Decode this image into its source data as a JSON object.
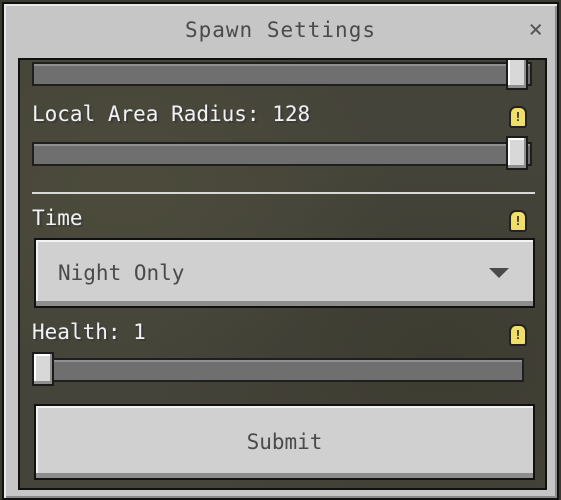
{
  "dialog": {
    "title": "Spawn Settings",
    "close_label": "×"
  },
  "settings": [
    {
      "id": "top-slider",
      "value_fraction": 1.0
    },
    {
      "id": "local-area-radius",
      "label": "Local Area Radius: 128",
      "value_fraction": 1.0
    },
    {
      "id": "time",
      "label": "Time",
      "selected": "Night Only"
    },
    {
      "id": "health",
      "label": "Health: 1",
      "value_fraction": 0.0
    }
  ],
  "submit_label": "Submit",
  "info_glyph": "!",
  "colors": {
    "panel": "#c6c6c6",
    "background": "#45443a",
    "info": "#f0e06a"
  }
}
